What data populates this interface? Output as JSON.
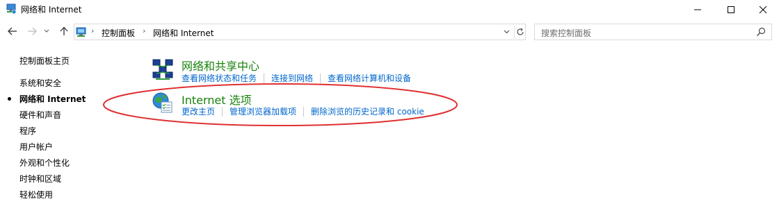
{
  "window": {
    "title": "网络和 Internet"
  },
  "navigation": {
    "breadcrumb": [
      "控制面板",
      "网络和 Internet"
    ],
    "search_placeholder": "搜索控制面板"
  },
  "sidebar": {
    "items": [
      {
        "label": "控制面板主页",
        "active": false
      },
      {
        "label": "系统和安全",
        "active": false
      },
      {
        "label": "网络和 Internet",
        "active": true
      },
      {
        "label": "硬件和声音",
        "active": false
      },
      {
        "label": "程序",
        "active": false
      },
      {
        "label": "用户帐户",
        "active": false
      },
      {
        "label": "外观和个性化",
        "active": false
      },
      {
        "label": "时钟和区域",
        "active": false
      },
      {
        "label": "轻松使用",
        "active": false
      }
    ]
  },
  "categories": [
    {
      "title": "网络和共享中心",
      "icon": "network-sharing-icon",
      "tasks": [
        "查看网络状态和任务",
        "连接到网络",
        "查看网络计算机和设备"
      ]
    },
    {
      "title": "Internet 选项",
      "icon": "internet-options-icon",
      "tasks": [
        "更改主页",
        "管理浏览器加载项",
        "删除浏览的历史记录和 cookie"
      ]
    }
  ],
  "colors": {
    "category_title": "#19820d",
    "task_link": "#0066cc",
    "annotation_ellipse": "#e03030"
  }
}
